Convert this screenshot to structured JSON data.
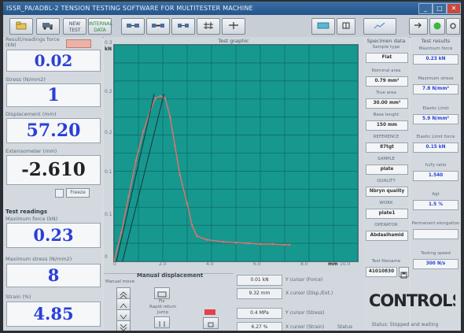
{
  "window": {
    "title": "ISSR_PA/ADBL-2 TENSION TESTING SOFTWARE FOR MULTITESTER MACHINE",
    "minimize": "_",
    "maximize": "□",
    "close": "✕"
  },
  "toolbar": {
    "btn_newtest": "NEW TEST",
    "btn_internal": "INTERNAL DATA"
  },
  "readings": {
    "force_label": "Result/readings force (kN)",
    "force_value": "0.02",
    "stress_label": "Stress (N/mm2)",
    "stress_value": "1",
    "displacement_label": "Displacement (mm)",
    "displacement_value": "57.20",
    "extensometer_label": "Extensometer (mm)",
    "extensometer_value": "-2.610",
    "freeze_label": "Freeze",
    "test_readings_title": "Test readings",
    "max_force_label": "Maximum force (kN)",
    "max_force_value": "0.23",
    "max_stress_label": "Maximum stress (N/mm2)",
    "max_stress_value": "8",
    "strain_label": "Strain (%)",
    "strain_value": "4.85"
  },
  "graph": {
    "title": "Test graphic",
    "y_unit": "kN",
    "y_ticks": [
      "0.3",
      "0.2",
      "0.2",
      "0.1",
      "0.1",
      "0"
    ],
    "x_ticks": [
      "0",
      "2.0",
      "4.0",
      "6.0",
      "8.0",
      "10.0"
    ],
    "x_unit": "mm"
  },
  "chart_data": {
    "type": "line",
    "title": "Test graphic",
    "xlabel": "mm",
    "ylabel": "kN",
    "xlim": [
      0,
      10
    ],
    "ylim": [
      0,
      0.3
    ],
    "grid": true,
    "series": [
      {
        "color": "#e8706a",
        "x": [
          0,
          0.3,
          0.6,
          0.9,
          1.2,
          1.5,
          1.7,
          1.9,
          2.1,
          2.3,
          2.5,
          2.7,
          3.0,
          3.2,
          3.4,
          3.8,
          4.5,
          5.0,
          5.5,
          6.0,
          6.5,
          7.0,
          7.2
        ],
        "y": [
          0,
          0.04,
          0.09,
          0.14,
          0.18,
          0.21,
          0.226,
          0.229,
          0.226,
          0.2,
          0.16,
          0.12,
          0.08,
          0.05,
          0.035,
          0.03,
          0.027,
          0.026,
          0.025,
          0.024,
          0.024,
          0.023,
          0.023
        ]
      },
      {
        "color": "#1b2a30",
        "x": [
          0.1,
          1.65
        ],
        "y": [
          0,
          0.232
        ]
      },
      {
        "color": "#1b2a30",
        "x": [
          0.35,
          2.05
        ],
        "y": [
          0,
          0.232
        ]
      }
    ]
  },
  "manual": {
    "title": "Manual displacement",
    "manual_move": "Manual move",
    "fix_label": "Fix",
    "rapid_return": "Rapid return",
    "jump_label": "Jump"
  },
  "cursors": {
    "force_value": "0.01 kN",
    "force_label": "Y cursor (Force)",
    "disp_value": "9.32 mm",
    "disp_label": "X cursor (Disp./Ext.)",
    "stress_value": "0.4 MPa",
    "stress_label": "Y cursor (Stress)",
    "strain_value": "6.27 %",
    "strain_label": "X cursor (Strain)",
    "status_word": "Status"
  },
  "specimen": {
    "title": "Specimen data",
    "sample_type_label": "Sample type",
    "sample_type": "Flat",
    "nominal_area_label": "Nominal area",
    "nominal_area": "0.79 mm²",
    "true_area_label": "True area",
    "true_area": "30.00 mm²",
    "base_length_label": "Base lenght",
    "base_length": "150 mm",
    "reference_label": "REFERENCE",
    "reference": "87tgt",
    "sample_label": "SAMPLE",
    "sample": "plate",
    "quality_label": "QUALITY",
    "quality": "Nbryn quality",
    "work_label": "WORK",
    "work": "plate1",
    "operator_label": "OPERATOR",
    "operator": "Abdaalhamid",
    "filename_label": "Test filename",
    "filename": "41010830"
  },
  "results": {
    "title": "Test results",
    "max_force_label": "Maximum force",
    "max_force": "0.23 kN",
    "max_stress_label": "Maximum stress",
    "max_stress": "7.8 N/mm²",
    "elastic_limit_label": "Elastic Limit",
    "elastic_limit": "5.9 N/mm²",
    "elastic_force_label": "Elastic Limit force",
    "elastic_force": "0.15 kN",
    "fu_fy_label": "fu/fy ratio",
    "fu_fy": "1.540",
    "agt_label": "Agt",
    "agt": "1.5 %",
    "perm_elong_label": "Permanent elongation",
    "perm_elong": "",
    "speed_label": "Testing speed",
    "speed": "300 N/s"
  },
  "brand": {
    "logo_text": "CONTROLS"
  },
  "status": {
    "text": "Status: Stopped and waiting"
  },
  "colors": {
    "plot_bg": "#16988f",
    "value_blue": "#2a3fd6",
    "curve": "#e8706a"
  }
}
